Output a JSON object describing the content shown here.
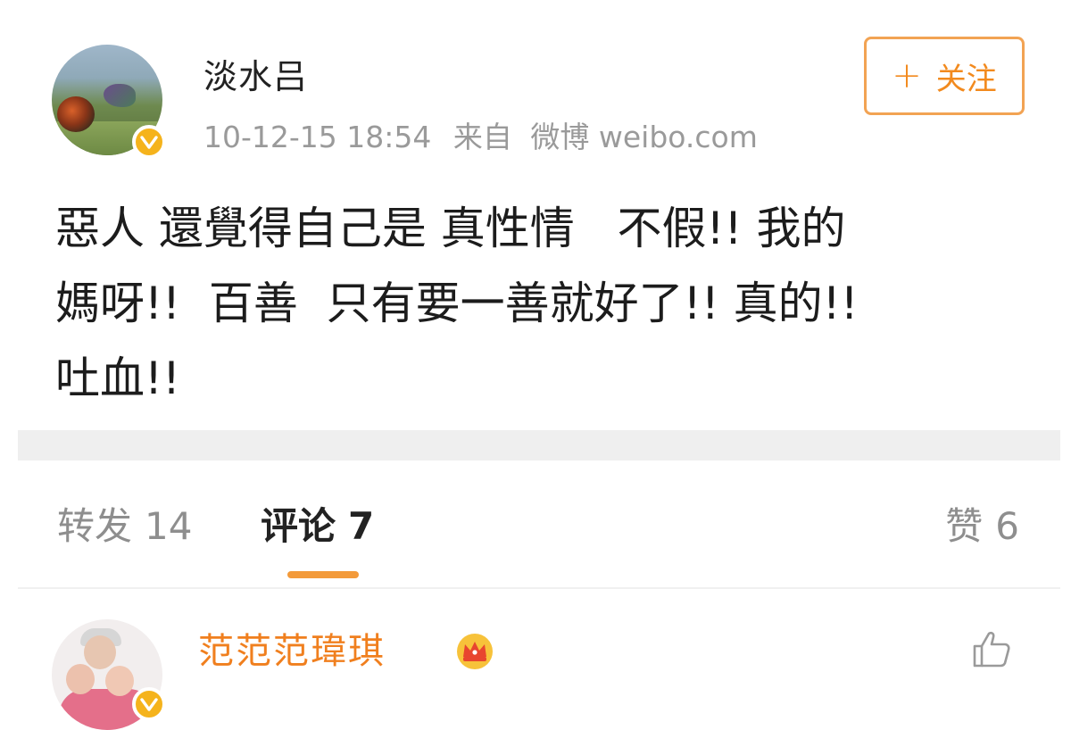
{
  "post": {
    "author": "淡水吕",
    "timestamp": "10-12-15 18:54",
    "source_prefix": "来自",
    "source": "微博 weibo.com",
    "follow_label": "关注",
    "follow_icon": "+",
    "body": "惡人 還覺得自己是 真性情   不假!! 我的\n媽呀!!  百善  只有要一善就好了!! 真的!!\n吐血!!"
  },
  "tabs": {
    "repost": {
      "label": "转发",
      "count": "14"
    },
    "comments": {
      "label": "评论",
      "count": "7"
    },
    "likes": {
      "label": "赞",
      "count": "6"
    }
  },
  "comment": {
    "author": "范范范瑋琪"
  },
  "icons": {
    "verified": "verified-badge-icon",
    "crown": "crown-icon",
    "thumb_up": "thumb-up-icon"
  },
  "colors": {
    "accent_orange": "#f28a1e",
    "verified_yellow": "#f5b31c",
    "tab_indicator": "#f39a3a",
    "muted_text": "#9a9a9a"
  }
}
